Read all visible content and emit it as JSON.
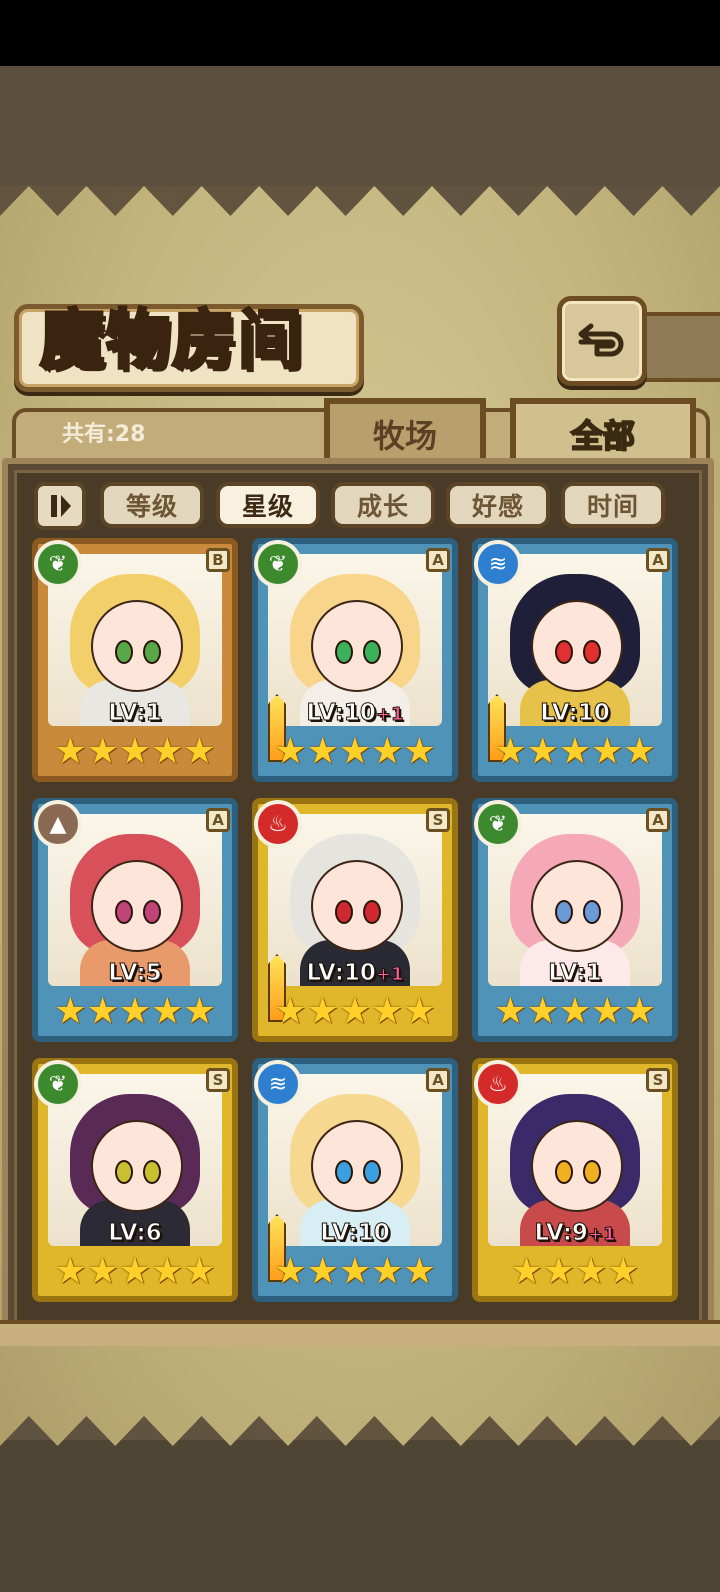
{
  "page_title": "魔物房间",
  "count_label": "共有:28",
  "tabs": [
    {
      "label": "牧场",
      "active": false
    },
    {
      "label": "全部",
      "active": true
    }
  ],
  "sort_buttons": [
    {
      "label": "等级",
      "active": false
    },
    {
      "label": "星级",
      "active": true
    },
    {
      "label": "成长",
      "active": false
    },
    {
      "label": "好感",
      "active": false
    },
    {
      "label": "时间",
      "active": false
    }
  ],
  "cards": [
    {
      "rank": "B",
      "element": "leaf",
      "level": "LV:1",
      "bonus": "",
      "stars": 5,
      "frame": "bronze",
      "weapon": false,
      "hair": "#f3cf6a",
      "eyes": "#58a84a",
      "outfit": "#e9e7e2"
    },
    {
      "rank": "A",
      "element": "leaf",
      "level": "LV:10",
      "bonus": "+1",
      "stars": 5,
      "frame": "blue",
      "weapon": true,
      "hair": "#f8d58a",
      "eyes": "#3bb25a",
      "outfit": "#f3efe8"
    },
    {
      "rank": "A",
      "element": "water",
      "level": "LV:10",
      "bonus": "",
      "stars": 5,
      "frame": "blue",
      "weapon": true,
      "hair": "#1f1f3a",
      "eyes": "#e03030",
      "outfit": "#e6c24a"
    },
    {
      "rank": "A",
      "element": "earth",
      "level": "LV:5",
      "bonus": "",
      "stars": 5,
      "frame": "blue",
      "weapon": false,
      "hair": "#d8505a",
      "eyes": "#c0447a",
      "outfit": "#e99a6a"
    },
    {
      "rank": "S",
      "element": "fire",
      "level": "LV:10",
      "bonus": "+1",
      "stars": 5,
      "frame": "gold",
      "weapon": true,
      "hair": "#e6e4df",
      "eyes": "#d02830",
      "outfit": "#2a2a34"
    },
    {
      "rank": "A",
      "element": "leaf",
      "level": "LV:1",
      "bonus": "",
      "stars": 5,
      "frame": "blue",
      "weapon": false,
      "hair": "#f4a8b8",
      "eyes": "#6a9ad8",
      "outfit": "#fde9ea"
    },
    {
      "rank": "S",
      "element": "leaf",
      "level": "LV:6",
      "bonus": "",
      "stars": 5,
      "frame": "gold",
      "weapon": false,
      "hair": "#5a2a56",
      "eyes": "#c8c030",
      "outfit": "#2c2a34"
    },
    {
      "rank": "A",
      "element": "water",
      "level": "LV:10",
      "bonus": "",
      "stars": 5,
      "frame": "blue",
      "weapon": true,
      "hair": "#f6d890",
      "eyes": "#3aa0e0",
      "outfit": "#d6eef4"
    },
    {
      "rank": "S",
      "element": "fire",
      "level": "LV:9",
      "bonus": "+1",
      "stars": 4,
      "frame": "gold",
      "weapon": false,
      "hair": "#3a2a6a",
      "eyes": "#f0b020",
      "outfit": "#c84a4a"
    }
  ],
  "element_icons": {
    "leaf": "leaf-icon",
    "water": "water-icon",
    "fire": "fire-icon",
    "earth": "earth-icon"
  },
  "colors": {
    "leaf": "#3d8a2e",
    "water": "#2f7fd0",
    "fire": "#d42a2a",
    "earth": "#8a6a52",
    "frame_blue": "#4f93b8",
    "frame_gold": "#e0b72a",
    "frame_bronze": "#c98a3c"
  }
}
